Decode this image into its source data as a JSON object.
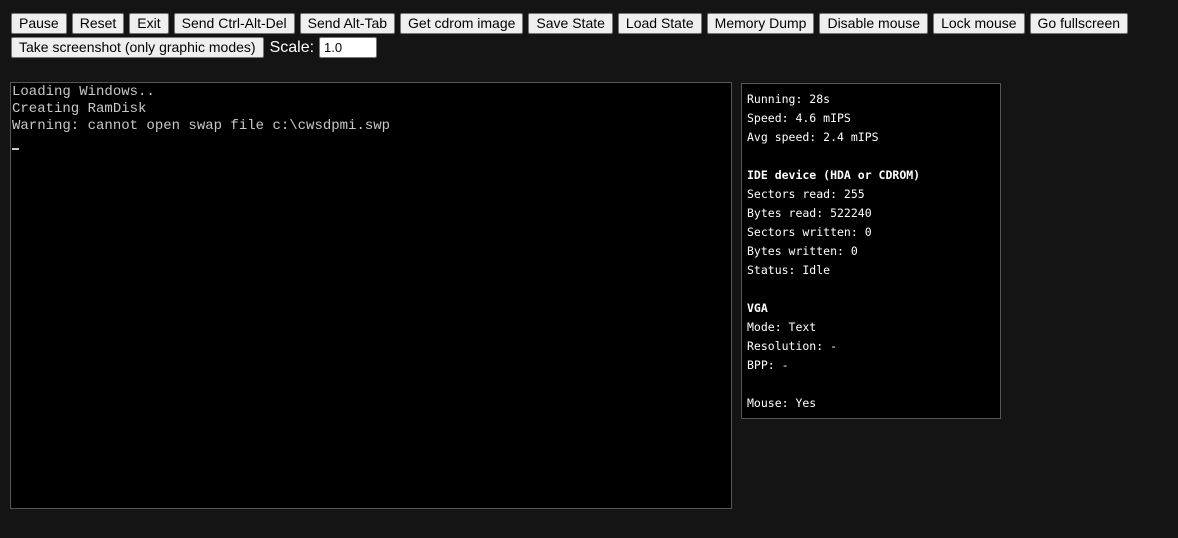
{
  "toolbar": {
    "row1": [
      {
        "name": "pause-button",
        "label": "Pause"
      },
      {
        "name": "reset-button",
        "label": "Reset"
      },
      {
        "name": "exit-button",
        "label": "Exit"
      },
      {
        "name": "send-ctrl-alt-del-button",
        "label": "Send Ctrl-Alt-Del"
      },
      {
        "name": "send-alt-tab-button",
        "label": "Send Alt-Tab"
      },
      {
        "name": "get-cdrom-image-button",
        "label": "Get cdrom image"
      },
      {
        "name": "save-state-button",
        "label": "Save State"
      },
      {
        "name": "load-state-button",
        "label": "Load State"
      },
      {
        "name": "memory-dump-button",
        "label": "Memory Dump"
      },
      {
        "name": "disable-mouse-button",
        "label": "Disable mouse"
      },
      {
        "name": "lock-mouse-button",
        "label": "Lock mouse"
      },
      {
        "name": "go-fullscreen-button",
        "label": "Go fullscreen"
      }
    ],
    "screenshot_label": "Take screenshot (only graphic modes)",
    "scale_label": "Scale:",
    "scale_value": "1.0"
  },
  "screen": {
    "lines": [
      "Loading Windows..",
      "Creating RamDisk",
      "Warning: cannot open swap file c:\\cwsdpmi.swp"
    ]
  },
  "info": {
    "running": "Running: 28s",
    "speed": "Speed: 4.6 mIPS",
    "avg_speed": "Avg speed: 2.4 mIPS",
    "ide_header": "IDE device (HDA or CDROM)",
    "sectors_read": "Sectors read: 255",
    "bytes_read": "Bytes read: 522240",
    "sectors_written": "Sectors written: 0",
    "bytes_written": "Bytes written: 0",
    "status": "Status: Idle",
    "vga_header": "VGA",
    "mode": "Mode: Text",
    "resolution": "Resolution: -",
    "bpp": "BPP: -",
    "mouse": "Mouse: Yes"
  }
}
